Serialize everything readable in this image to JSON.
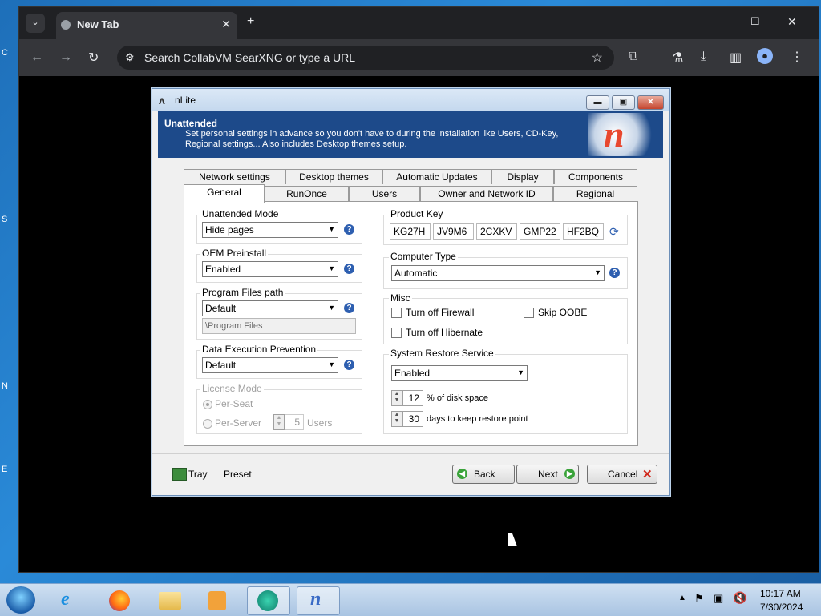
{
  "desktop": {
    "icon_labels": [
      "C",
      "S",
      "N",
      "E"
    ]
  },
  "browser": {
    "tab_title": "New Tab",
    "tab_close": "✕",
    "new_tab": "+",
    "omnibox_placeholder": "Search CollabVM SearXNG or type a URL",
    "window_controls": [
      "—",
      "☐",
      "✕"
    ]
  },
  "nlite": {
    "title": "nLite",
    "banner": {
      "heading": "Unattended",
      "description": "Set personal settings in advance so you don't have to during the installation like Users, CD-Key, Regional settings... Also includes Desktop themes setup."
    },
    "tabs_top": [
      "Network settings",
      "Desktop themes",
      "Automatic Updates",
      "Display",
      "Components"
    ],
    "tabs_bottom": [
      "General",
      "RunOnce",
      "Users",
      "Owner and Network ID",
      "Regional"
    ],
    "active_tab": "General",
    "left": {
      "unattended_mode": {
        "label": "Unattended Mode",
        "value": "Hide pages"
      },
      "oem_preinstall": {
        "label": "OEM Preinstall",
        "value": "Enabled"
      },
      "program_files": {
        "label": "Program Files path",
        "value": "Default",
        "path": "\\Program Files"
      },
      "dep": {
        "label": "Data Execution Prevention",
        "value": "Default"
      },
      "license": {
        "label": "License Mode",
        "per_seat": "Per-Seat",
        "per_server": "Per-Server",
        "users_count": "5",
        "users_label": "Users"
      }
    },
    "right": {
      "product_key": {
        "label": "Product Key",
        "parts": [
          "KG27H",
          "JV9M6",
          "2CXKV",
          "GMP22",
          "HF2BQ"
        ]
      },
      "computer_type": {
        "label": "Computer Type",
        "value": "Automatic"
      },
      "misc": {
        "label": "Misc",
        "firewall": "Turn off Firewall",
        "hibernate": "Turn off Hibernate",
        "oobe": "Skip OOBE"
      },
      "restore": {
        "label": "System Restore Service",
        "value": "Enabled",
        "disk_pct": "12",
        "disk_label": "% of disk space",
        "days": "30",
        "days_label": "days to keep restore point"
      }
    },
    "footer": {
      "tray": "Tray",
      "preset": "Preset",
      "back": "Back",
      "next": "Next",
      "cancel": "Cancel"
    }
  },
  "taskbar": {
    "time": "10:17 AM",
    "date": "7/30/2024"
  }
}
